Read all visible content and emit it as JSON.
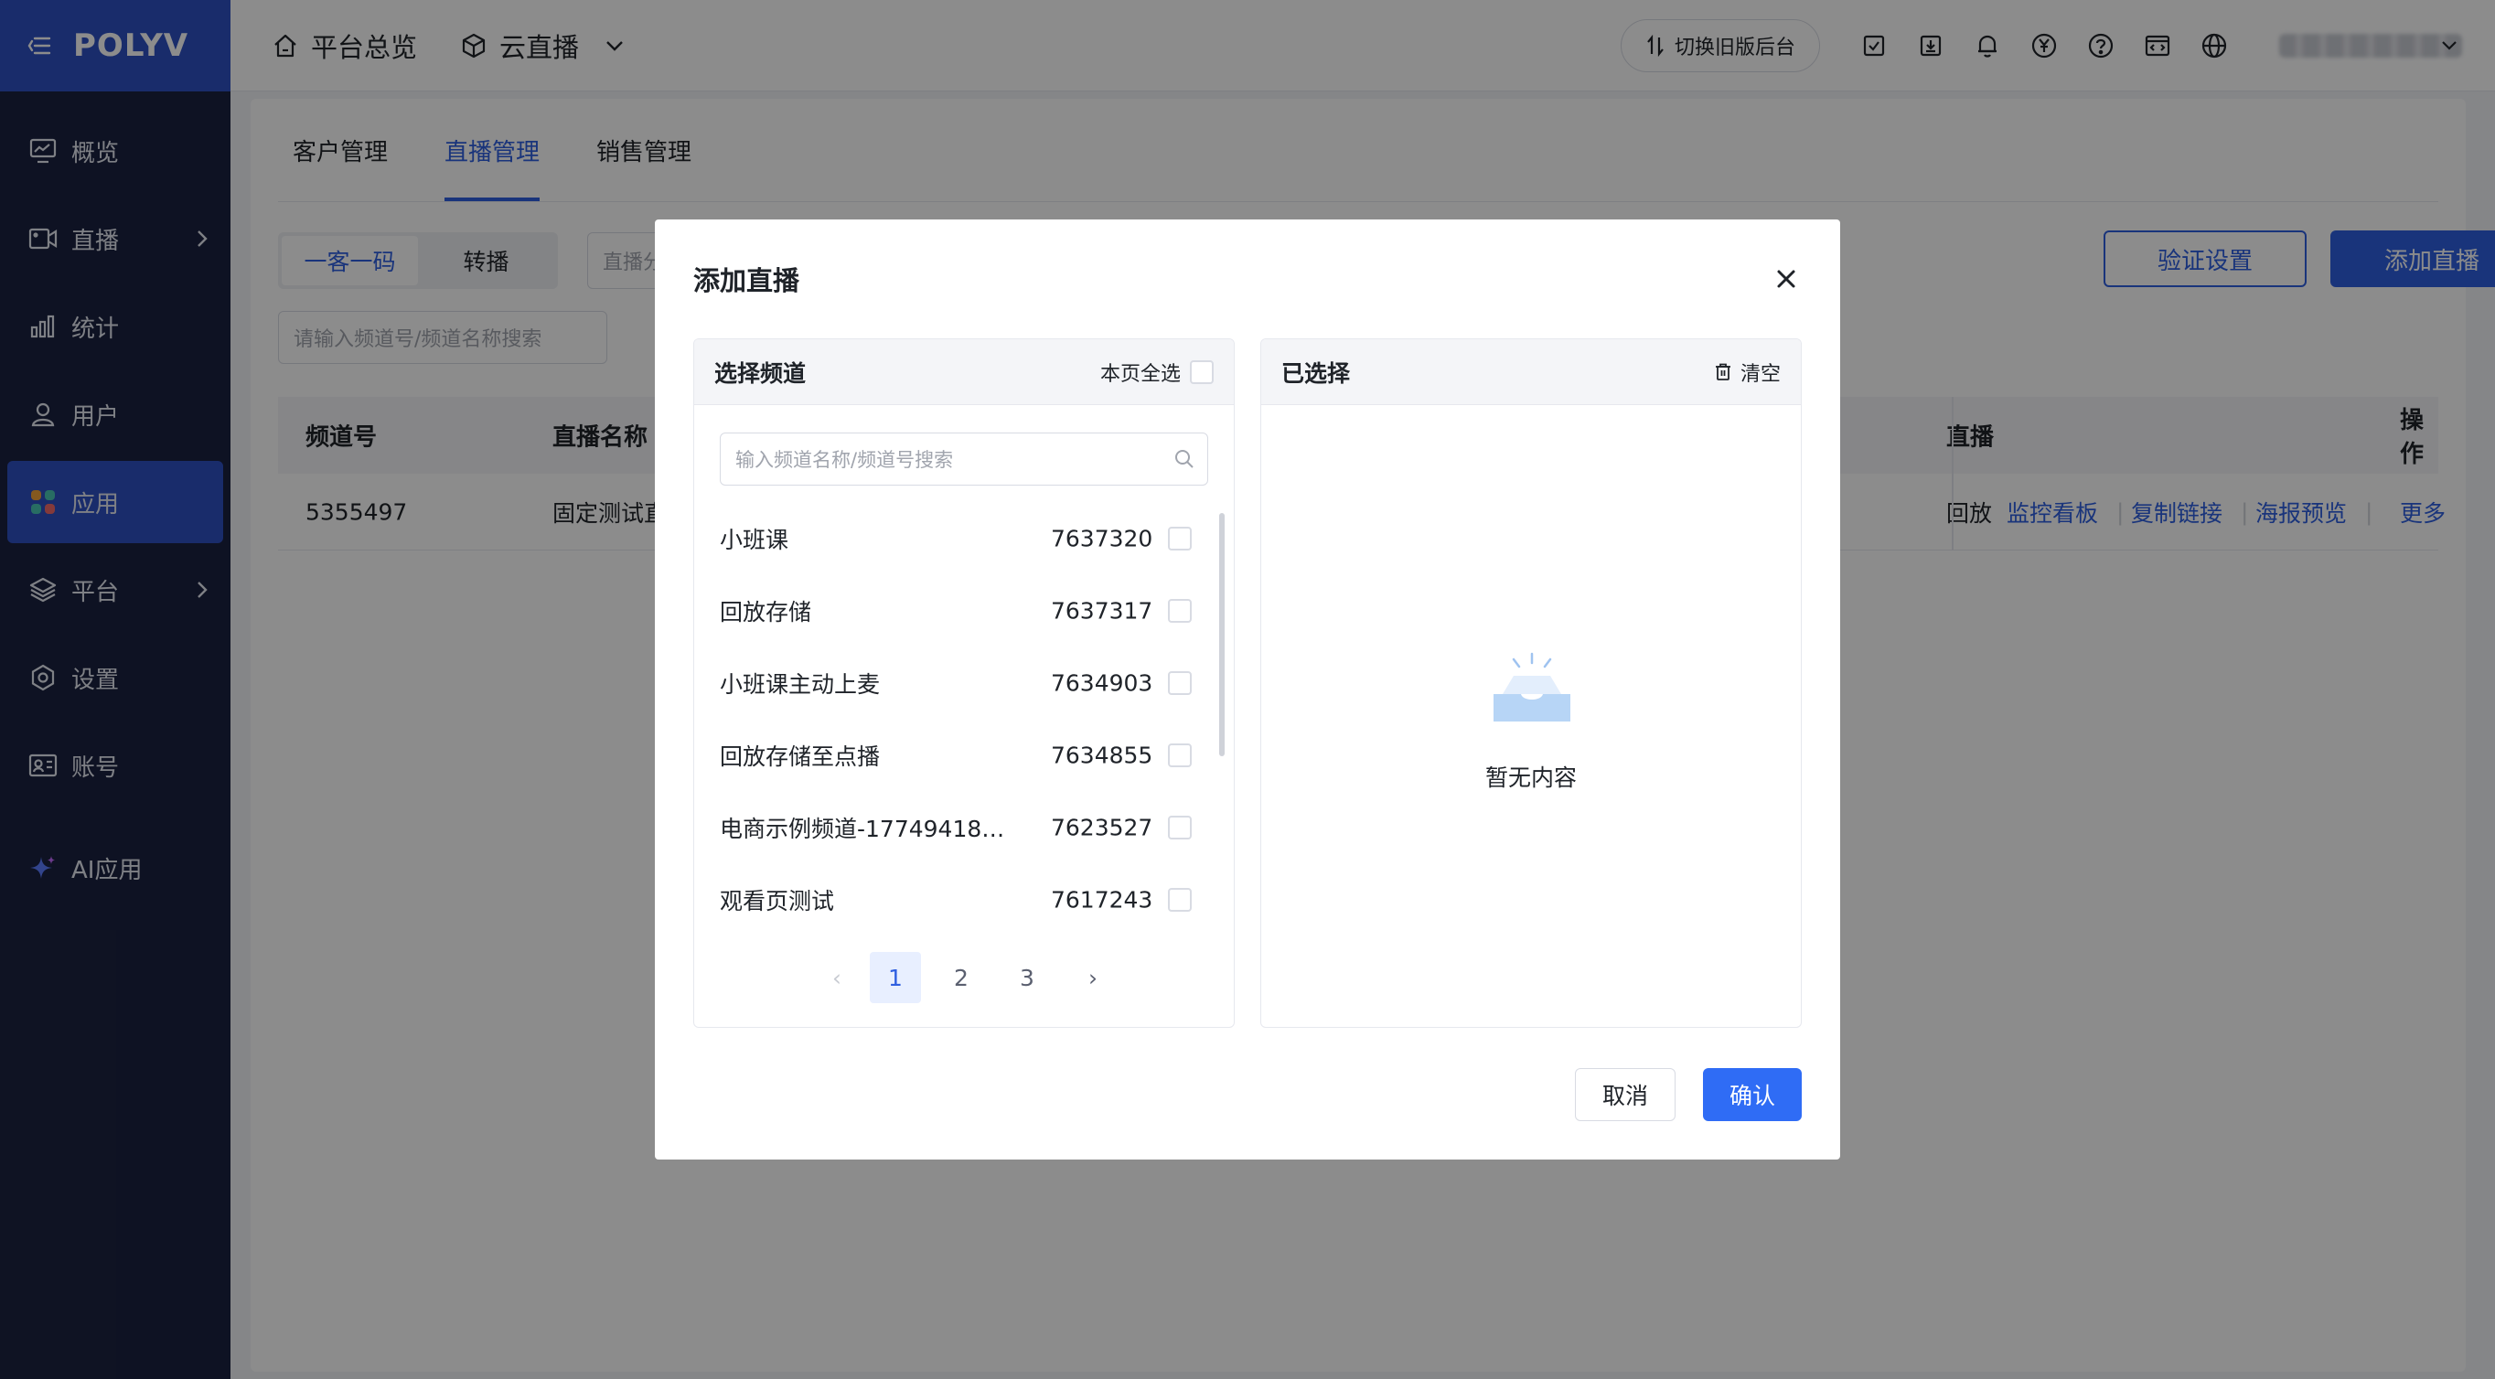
{
  "brand": {
    "logo": "POLYV"
  },
  "sidebar": {
    "items": [
      {
        "label": "概览",
        "icon": "monitor-icon",
        "has_children": false,
        "active": false
      },
      {
        "label": "直播",
        "icon": "video-camera-icon",
        "has_children": true,
        "active": false
      },
      {
        "label": "统计",
        "icon": "bar-chart-icon",
        "has_children": false,
        "active": false
      },
      {
        "label": "用户",
        "icon": "user-icon",
        "has_children": false,
        "active": false
      },
      {
        "label": "应用",
        "icon": "apps-icon",
        "has_children": false,
        "active": true
      },
      {
        "label": "平台",
        "icon": "layers-icon",
        "has_children": true,
        "active": false
      },
      {
        "label": "设置",
        "icon": "gear-icon",
        "has_children": false,
        "active": false
      },
      {
        "label": "账号",
        "icon": "id-card-icon",
        "has_children": false,
        "active": false
      },
      {
        "label": "AI应用",
        "icon": "sparkle-icon",
        "has_children": false,
        "active": false
      }
    ]
  },
  "topbar": {
    "home_label": "平台总览",
    "product_label": "云直播",
    "switch_label": "切换旧版后台",
    "icons": [
      "task-icon",
      "download-icon",
      "bell-icon",
      "yen-icon",
      "help-icon",
      "code-window-icon",
      "globe-icon"
    ]
  },
  "page": {
    "tabs": [
      "客户管理",
      "直播管理",
      "销售管理"
    ],
    "active_tab": 1,
    "segment": [
      "一客一码",
      "转播"
    ],
    "filter_placeholder": "直播分",
    "search_placeholder": "请输入频道号/频道名称搜索",
    "btn_verify": "验证设置",
    "btn_add": "添加直播",
    "table": {
      "headers": {
        "channel": "频道号",
        "name": "直播名称",
        "status": "直播",
        "ops": "操作"
      },
      "rows": [
        {
          "channel": "5355497",
          "name": "固定测试直",
          "status": "回放",
          "actions": [
            "监控看板",
            "复制链接",
            "海报预览",
            "更多"
          ]
        }
      ]
    }
  },
  "modal": {
    "title": "添加直播",
    "left": {
      "title": "选择频道",
      "select_all": "本页全选",
      "search_placeholder": "输入频道名称/频道号搜索",
      "items": [
        {
          "name": "小班课",
          "id": "7637320"
        },
        {
          "name": "回放存储",
          "id": "7637317"
        },
        {
          "name": "小班课主动上麦",
          "id": "7634903"
        },
        {
          "name": "回放存储至点播",
          "id": "7634855"
        },
        {
          "name": "电商示例频道-177494182...",
          "id": "7623527"
        },
        {
          "name": "观看页测试",
          "id": "7617243"
        }
      ],
      "pager": {
        "prev": "‹",
        "pages": [
          "1",
          "2",
          "3"
        ],
        "current": "1",
        "next": "›"
      }
    },
    "right": {
      "title": "已选择",
      "clear": "清空",
      "empty": "暂无内容"
    },
    "cancel": "取消",
    "confirm": "确认"
  },
  "colors": {
    "primary": "#2f5fe0",
    "sidebar_bg": "#1b2240",
    "logo_bg": "#2f50c4"
  }
}
